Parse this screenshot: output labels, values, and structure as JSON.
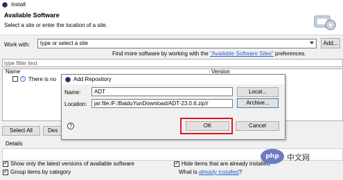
{
  "window": {
    "title": "Install"
  },
  "header": {
    "title": "Available Software",
    "subtitle": "Select a site or enter the location of a site."
  },
  "work_with": {
    "label": "Work with:",
    "value": "type or select a site",
    "add_label": "Add..."
  },
  "find_more": {
    "prefix": "Find more software by working with the ",
    "link": "\"Available Software Sites\"",
    "suffix": " preferences."
  },
  "filter": {
    "placeholder": "type filter text"
  },
  "list": {
    "columns": [
      "Name",
      "Version"
    ],
    "row_text": "There is no"
  },
  "buttons": {
    "select_all": "Select All",
    "deselect_all": "Des"
  },
  "details": {
    "label": "Details"
  },
  "options": {
    "latest_versions": {
      "label": "Show only the latest versions of available software",
      "checked": true
    },
    "hide_installed": {
      "label": "Hide items that are already installed",
      "checked": true
    },
    "group_by_category": {
      "label": "Group items by category",
      "checked": true
    },
    "what_is_prefix": "What is ",
    "what_is_link": "already installed",
    "what_is_suffix": "?"
  },
  "dialog": {
    "title": "Add Repository",
    "name_label": "Name:",
    "name_value": "ADT",
    "local_label": "Local...",
    "location_label": "Location:",
    "location_value": "jar:file:/F:/BaiduYunDownload/ADT-23.0.6.zip!/",
    "archive_label": "Archive...",
    "help_glyph": "?",
    "ok_label": "OK",
    "cancel_label": "Cancel"
  },
  "watermark": {
    "logo": "php",
    "text": "中文网"
  },
  "colors": {
    "link": "#2f5fd3",
    "highlight": "#e0141a",
    "dialog_bg": "#f0f0f0"
  }
}
